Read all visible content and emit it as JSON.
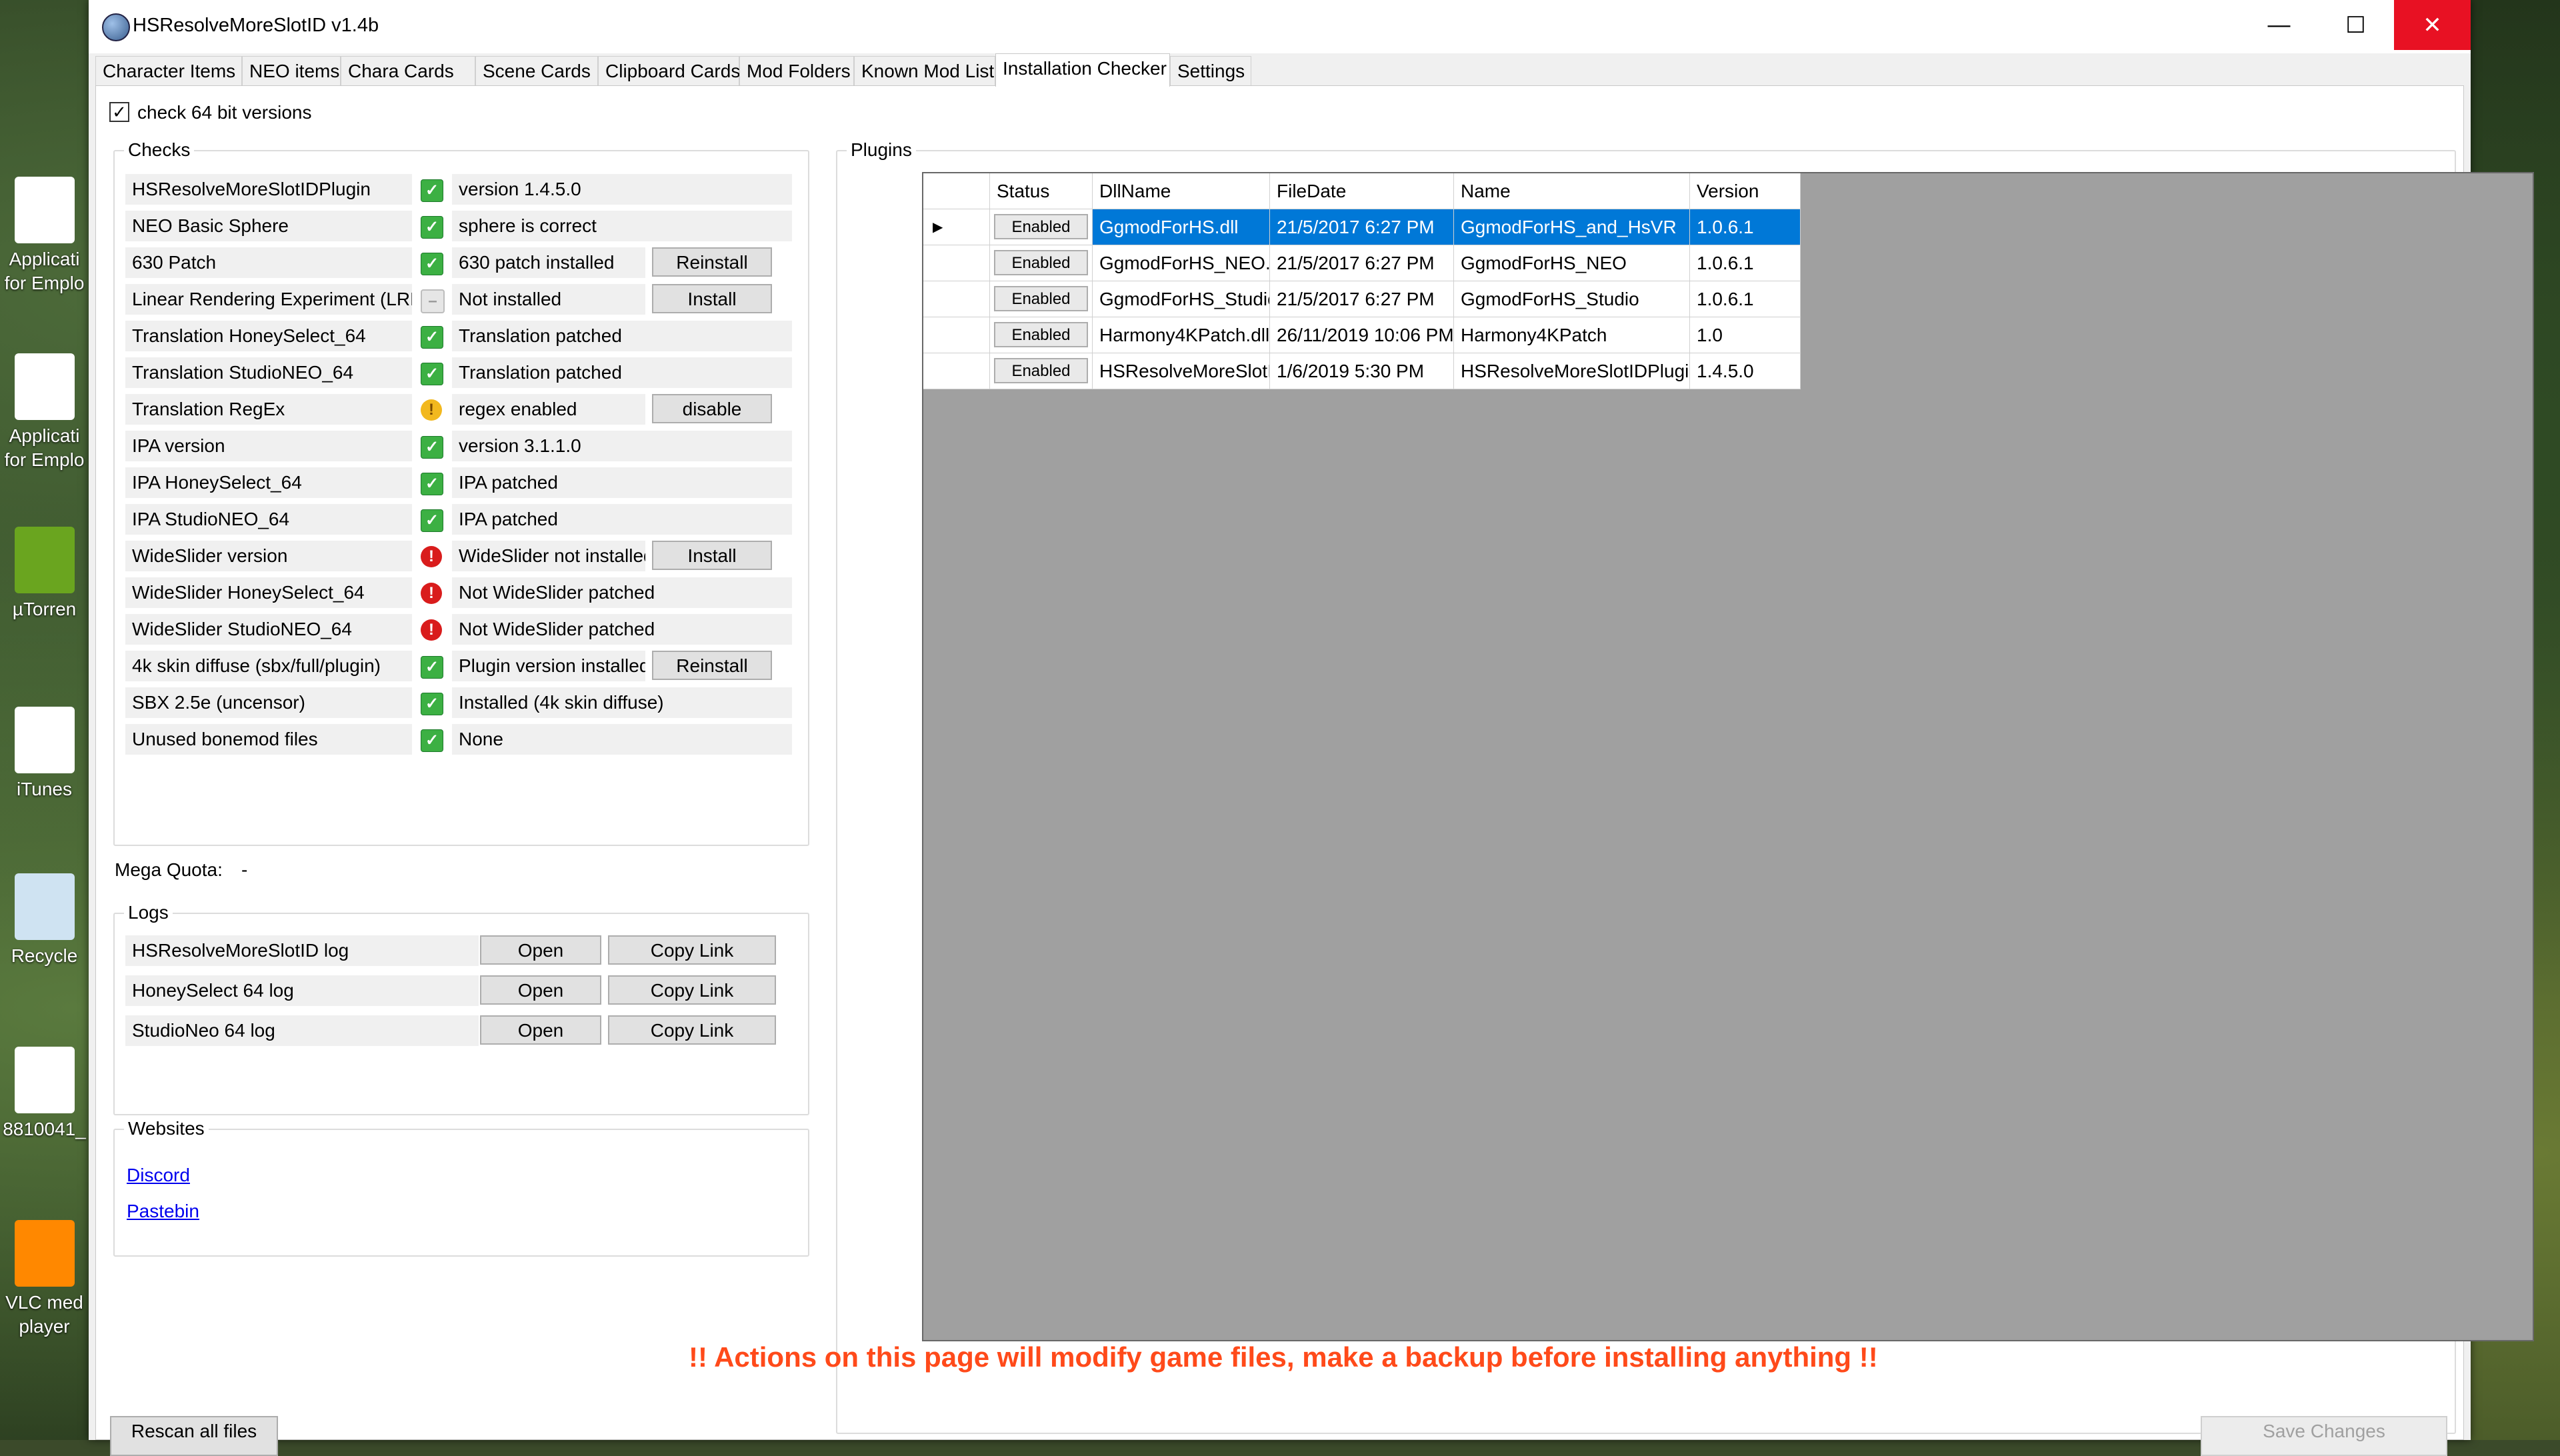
{
  "window": {
    "title": "HSResolveMoreSlotID v1.4b",
    "controls": {
      "minimize": "—",
      "maximize": "☐",
      "close": "✕"
    }
  },
  "desktop_icons": [
    {
      "label": "Applicati\nfor Emplo",
      "icon": "pdf-icon"
    },
    {
      "label": "Applicati\nfor Emplo",
      "icon": "word-icon"
    },
    {
      "label": "µTorren",
      "icon": "utorrent-icon"
    },
    {
      "label": "iTunes",
      "icon": "itunes-icon"
    },
    {
      "label": "Recycle",
      "icon": "recycle-bin-icon"
    },
    {
      "label": "8810041_",
      "icon": "word-icon"
    },
    {
      "label": "VLC med\nplayer",
      "icon": "vlc-icon"
    }
  ],
  "tabs": [
    "Character Items",
    "NEO items",
    "Chara Cards",
    "Scene Cards",
    "Clipboard Cards",
    "Mod Folders",
    "Known Mod List",
    "Installation Checker",
    "Settings"
  ],
  "check64_label": "check 64 bit versions",
  "checks": {
    "title": "Checks",
    "rows": [
      {
        "name": "HSResolveMoreSlotIDPlugin",
        "state": "ok",
        "status": "version 1.4.5.0",
        "button": ""
      },
      {
        "name": "NEO Basic Sphere",
        "state": "ok",
        "status": "sphere is correct",
        "button": ""
      },
      {
        "name": "630 Patch",
        "state": "ok",
        "status": "630 patch installed",
        "button": "Reinstall"
      },
      {
        "name": "Linear Rendering Experiment (LRE)",
        "state": "na",
        "status": "Not installed",
        "button": "Install"
      },
      {
        "name": "Translation HoneySelect_64",
        "state": "ok",
        "status": "Translation patched",
        "button": ""
      },
      {
        "name": "Translation StudioNEO_64",
        "state": "ok",
        "status": "Translation patched",
        "button": ""
      },
      {
        "name": "Translation RegEx",
        "state": "warn",
        "status": "regex enabled",
        "button": "disable"
      },
      {
        "name": "IPA version",
        "state": "ok",
        "status": "version 3.1.1.0",
        "button": ""
      },
      {
        "name": "IPA HoneySelect_64",
        "state": "ok",
        "status": "IPA patched",
        "button": ""
      },
      {
        "name": "IPA StudioNEO_64",
        "state": "ok",
        "status": "IPA patched",
        "button": ""
      },
      {
        "name": "WideSlider version",
        "state": "err",
        "status": "WideSlider not installed",
        "button": "Install"
      },
      {
        "name": "WideSlider HoneySelect_64",
        "state": "err",
        "status": "Not WideSlider patched",
        "button": ""
      },
      {
        "name": "WideSlider StudioNEO_64",
        "state": "err",
        "status": "Not WideSlider patched",
        "button": ""
      },
      {
        "name": "4k skin diffuse (sbx/full/plugin)",
        "state": "ok",
        "status": "Plugin version installed.",
        "button": "Reinstall"
      },
      {
        "name": "SBX 2.5e (uncensor)",
        "state": "ok",
        "status": "Installed (4k skin diffuse)",
        "button": ""
      },
      {
        "name": "Unused bonemod files",
        "state": "ok",
        "status": "None",
        "button": ""
      }
    ]
  },
  "mega_quota": {
    "label": "Mega Quota:",
    "value": "-"
  },
  "logs": {
    "title": "Logs",
    "rows": [
      {
        "name": "HSResolveMoreSlotID log",
        "open": "Open",
        "copy": "Copy Link"
      },
      {
        "name": "HoneySelect 64 log",
        "open": "Open",
        "copy": "Copy Link"
      },
      {
        "name": "StudioNeo 64 log",
        "open": "Open",
        "copy": "Copy Link"
      }
    ]
  },
  "websites": {
    "title": "Websites",
    "links": [
      "Discord",
      "Pastebin"
    ]
  },
  "plugins": {
    "title": "Plugins",
    "columns": [
      "Status",
      "DllName",
      "FileDate",
      "Name",
      "Version"
    ],
    "rows": [
      {
        "status": "Enabled",
        "dll": "GgmodForHS.dll",
        "date": "21/5/2017 6:27 PM",
        "name": "GgmodForHS_and_HsVR",
        "version": "1.0.6.1",
        "selected": true
      },
      {
        "status": "Enabled",
        "dll": "GgmodForHS_NEO.dll",
        "date": "21/5/2017 6:27 PM",
        "name": "GgmodForHS_NEO",
        "version": "1.0.6.1",
        "selected": false
      },
      {
        "status": "Enabled",
        "dll": "GgmodForHS_Studio.dll",
        "date": "21/5/2017 6:27 PM",
        "name": "GgmodForHS_Studio",
        "version": "1.0.6.1",
        "selected": false
      },
      {
        "status": "Enabled",
        "dll": "Harmony4KPatch.dll",
        "date": "26/11/2019 10:06 PM",
        "name": "Harmony4KPatch",
        "version": "1.0",
        "selected": false
      },
      {
        "status": "Enabled",
        "dll": "HSResolveMoreSlotIDPlugin.dll",
        "date": "1/6/2019 5:30 PM",
        "name": "HSResolveMoreSlotIDPlugin",
        "version": "1.4.5.0",
        "selected": false
      }
    ]
  },
  "warning": "!! Actions on this page will modify game files, make a backup before installing anything  !!",
  "bottom": {
    "rescan": "Rescan all files",
    "save": "Save Changes"
  }
}
